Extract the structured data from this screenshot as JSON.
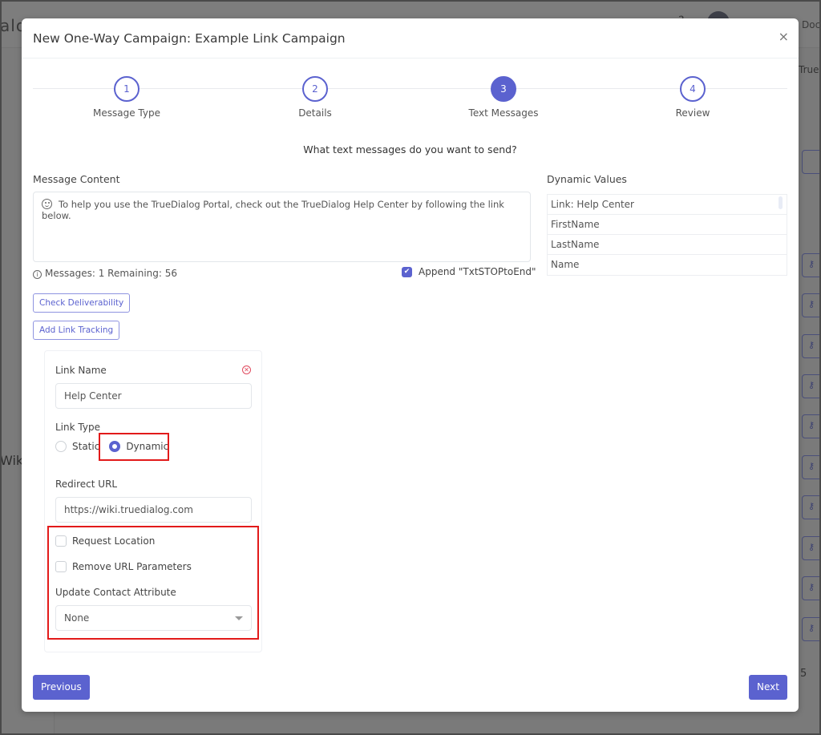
{
  "background": {
    "logo_fragment": "alo",
    "doc_fragment": "Docu",
    "truedialog_fragment": "TrueD",
    "wiki_fragment": "Wik",
    "page_number_fragment": "5",
    "row_action_icon": "key-icon"
  },
  "modal": {
    "title": "New One-Way Campaign: Example Link Campaign",
    "close_label": "×",
    "steps": [
      {
        "number": "1",
        "label": "Message Type",
        "state": "complete"
      },
      {
        "number": "2",
        "label": "Details",
        "state": "complete"
      },
      {
        "number": "3",
        "label": "Text Messages",
        "state": "active"
      },
      {
        "number": "4",
        "label": "Review",
        "state": "pending"
      }
    ],
    "prompt": "What text messages do you want to send?",
    "message_content": {
      "label": "Message Content",
      "text": "To help you use the TrueDialog Portal, check out the TrueDialog Help Center by following the link below.",
      "stats": "Messages: 1 Remaining: 56",
      "append_label": "Append \"TxtSTOPtoEnd\"",
      "append_checked": true
    },
    "dynamic_values": {
      "label": "Dynamic Values",
      "items": [
        "Link: Help Center",
        "FirstName",
        "LastName",
        "Name"
      ]
    },
    "buttons": {
      "check_deliverability": "Check Deliverability",
      "add_link_tracking": "Add Link Tracking",
      "previous": "Previous",
      "next": "Next"
    },
    "link_tracking": {
      "link_name_label": "Link Name",
      "link_name_value": "Help Center",
      "link_type_label": "Link Type",
      "link_type_options": [
        "Static",
        "Dynamic"
      ],
      "link_type_selected": "Dynamic",
      "redirect_url_label": "Redirect URL",
      "redirect_url_value": "https://wiki.truedialog.com",
      "request_location_label": "Request Location",
      "request_location_checked": false,
      "remove_url_params_label": "Remove URL Parameters",
      "remove_url_params_checked": false,
      "update_contact_attr_label": "Update Contact Attribute",
      "update_contact_attr_value": "None"
    }
  },
  "colors": {
    "accent": "#5b62cf",
    "highlight": "#e21a1a",
    "remove": "#e04a5e"
  }
}
